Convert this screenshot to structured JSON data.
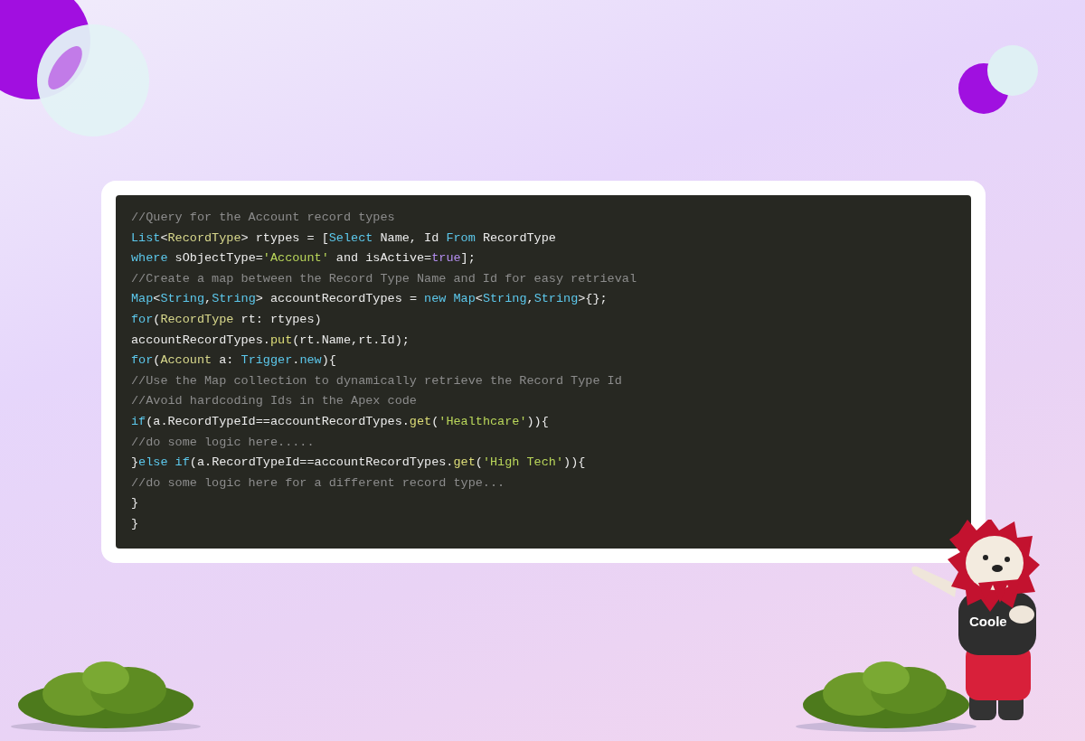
{
  "code_lines": [
    [
      {
        "kind": "comment",
        "text": "//Query for the Account record types"
      }
    ],
    [
      {
        "kind": "keyword",
        "text": "List"
      },
      {
        "kind": "plain",
        "text": "<"
      },
      {
        "kind": "type",
        "text": "RecordType"
      },
      {
        "kind": "plain",
        "text": "> rtypes = ["
      },
      {
        "kind": "keyword",
        "text": "Select"
      },
      {
        "kind": "plain",
        "text": " Name, Id "
      },
      {
        "kind": "keyword",
        "text": "From"
      },
      {
        "kind": "plain",
        "text": " RecordType"
      }
    ],
    [
      {
        "kind": "keyword",
        "text": "where"
      },
      {
        "kind": "plain",
        "text": " sObjectType="
      },
      {
        "kind": "string",
        "text": "'Account'"
      },
      {
        "kind": "plain",
        "text": " and isActive="
      },
      {
        "kind": "literal",
        "text": "true"
      },
      {
        "kind": "plain",
        "text": "];"
      }
    ],
    [
      {
        "kind": "comment",
        "text": "//Create a map between the Record Type Name and Id for easy retrieval"
      }
    ],
    [
      {
        "kind": "keyword",
        "text": "Map"
      },
      {
        "kind": "plain",
        "text": "<"
      },
      {
        "kind": "keyword",
        "text": "String"
      },
      {
        "kind": "plain",
        "text": ","
      },
      {
        "kind": "keyword",
        "text": "String"
      },
      {
        "kind": "plain",
        "text": "> accountRecordTypes = "
      },
      {
        "kind": "keyword",
        "text": "new "
      },
      {
        "kind": "keyword",
        "text": "Map"
      },
      {
        "kind": "plain",
        "text": "<"
      },
      {
        "kind": "keyword",
        "text": "String"
      },
      {
        "kind": "plain",
        "text": ","
      },
      {
        "kind": "keyword",
        "text": "String"
      },
      {
        "kind": "plain",
        "text": ">{};"
      }
    ],
    [
      {
        "kind": "keyword",
        "text": "for"
      },
      {
        "kind": "plain",
        "text": "("
      },
      {
        "kind": "type",
        "text": "RecordType"
      },
      {
        "kind": "plain",
        "text": " rt: rtypes)"
      }
    ],
    [
      {
        "kind": "plain",
        "text": "accountRecordTypes."
      },
      {
        "kind": "method",
        "text": "put"
      },
      {
        "kind": "plain",
        "text": "(rt.Name,rt.Id);"
      }
    ],
    [
      {
        "kind": "keyword",
        "text": "for"
      },
      {
        "kind": "plain",
        "text": "("
      },
      {
        "kind": "type",
        "text": "Account"
      },
      {
        "kind": "plain",
        "text": " a: "
      },
      {
        "kind": "keyword",
        "text": "Trigger"
      },
      {
        "kind": "plain",
        "text": "."
      },
      {
        "kind": "keyword",
        "text": "new"
      },
      {
        "kind": "plain",
        "text": "){"
      }
    ],
    [
      {
        "kind": "comment",
        "text": "//Use the Map collection to dynamically retrieve the Record Type Id"
      }
    ],
    [
      {
        "kind": "comment",
        "text": "//Avoid hardcoding Ids in the Apex code"
      }
    ],
    [
      {
        "kind": "keyword",
        "text": "if"
      },
      {
        "kind": "plain",
        "text": "(a.RecordTypeId==accountRecordTypes."
      },
      {
        "kind": "method",
        "text": "get"
      },
      {
        "kind": "plain",
        "text": "("
      },
      {
        "kind": "string",
        "text": "'Healthcare'"
      },
      {
        "kind": "plain",
        "text": ")){"
      }
    ],
    [
      {
        "kind": "comment",
        "text": "//do some logic here....."
      }
    ],
    [
      {
        "kind": "plain",
        "text": "}"
      },
      {
        "kind": "keyword",
        "text": "else if"
      },
      {
        "kind": "plain",
        "text": "(a.RecordTypeId==accountRecordTypes."
      },
      {
        "kind": "method",
        "text": "get"
      },
      {
        "kind": "plain",
        "text": "("
      },
      {
        "kind": "string",
        "text": "'High Tech'"
      },
      {
        "kind": "plain",
        "text": ")){"
      }
    ],
    [
      {
        "kind": "comment",
        "text": "//do some logic here for a different record type..."
      }
    ],
    [
      {
        "kind": "plain",
        "text": "}"
      }
    ],
    [
      {
        "kind": "plain",
        "text": "}"
      }
    ]
  ],
  "mascot": {
    "shirt_text": "Coole"
  }
}
